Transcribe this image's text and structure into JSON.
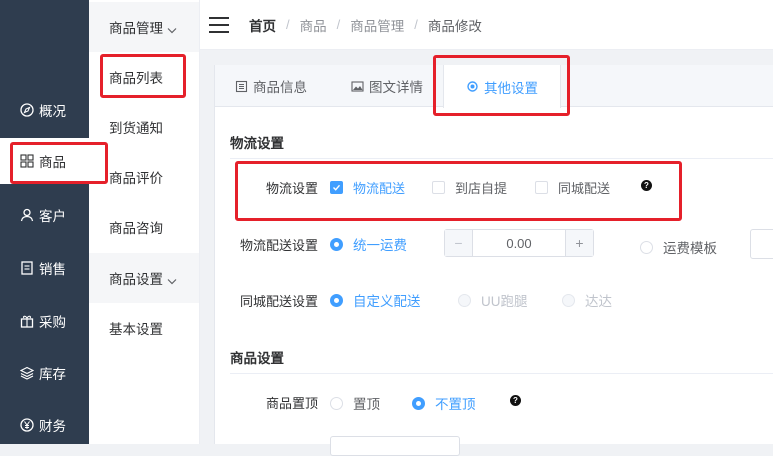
{
  "sidebar": {
    "items": [
      {
        "label": "概况",
        "icon": "compass-icon"
      },
      {
        "label": "商品",
        "icon": "grid-icon"
      },
      {
        "label": "客户",
        "icon": "user-icon"
      },
      {
        "label": "销售",
        "icon": "document-icon"
      },
      {
        "label": "采购",
        "icon": "gift-icon"
      },
      {
        "label": "库存",
        "icon": "layers-icon"
      },
      {
        "label": "财务",
        "icon": "yen-icon"
      }
    ]
  },
  "submenu": {
    "group1": "商品管理",
    "items1": [
      "商品列表",
      "到货通知",
      "商品评价",
      "商品咨询"
    ],
    "group2": "商品设置",
    "items2": [
      "基本设置"
    ]
  },
  "breadcrumb": [
    "首页",
    "商品",
    "商品管理",
    "商品修改"
  ],
  "tabs": [
    "商品信息",
    "图文详情",
    "其他设置"
  ],
  "logistics": {
    "title": "物流设置",
    "setting_label": "物流设置",
    "options": [
      "物流配送",
      "到店自提",
      "同城配送"
    ],
    "help": "?",
    "delivery_label": "物流配送设置",
    "uniform_fee": "统一运费",
    "fee_value": "0.00",
    "minus": "−",
    "plus": "+",
    "template": "运费模板",
    "city_label": "同城配送设置",
    "city_options": [
      "自定义配送",
      "UU跑腿",
      "达达"
    ]
  },
  "goods": {
    "title": "商品设置",
    "pin_label": "商品置顶",
    "pin_options": [
      "置顶",
      "不置顶"
    ],
    "help": "?"
  },
  "colors": {
    "accent": "#409eff",
    "sidebar": "#2f3d4f",
    "highlight": "#e5202a"
  }
}
